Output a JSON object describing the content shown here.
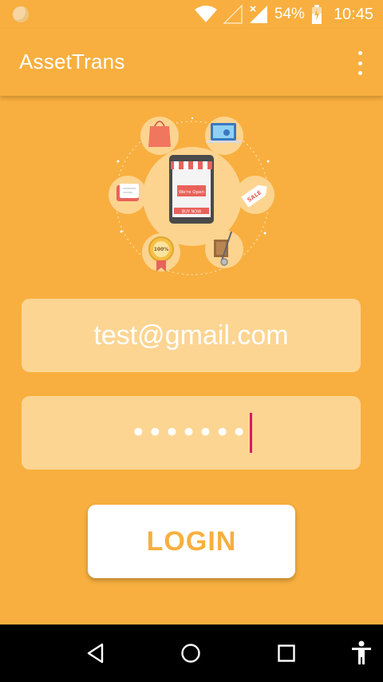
{
  "status_bar": {
    "battery_percent": "54%",
    "time": "10:45",
    "icons": [
      "moon-icon",
      "wifi-icon",
      "signal-empty-icon",
      "signal-icon",
      "battery-charging-icon"
    ]
  },
  "app_bar": {
    "title": "AssetTrans",
    "menu_icon": "more-vertical-icon"
  },
  "illustration": {
    "sign_text": "We're Open",
    "button_text": "BUY NOW",
    "tag_text": "SALE",
    "badge_text": "100%"
  },
  "form": {
    "email_value": "test@gmail.com",
    "password_mask": "•••••••"
  },
  "login_button": {
    "label": "LOGIN"
  },
  "nav_bar": {
    "icons": [
      "back-icon",
      "home-icon",
      "recents-icon",
      "accessibility-icon"
    ]
  },
  "colors": {
    "background": "#F8AF3F",
    "field": "#FCD592",
    "caret": "#D81B60",
    "button_text": "#F8AF3F"
  }
}
